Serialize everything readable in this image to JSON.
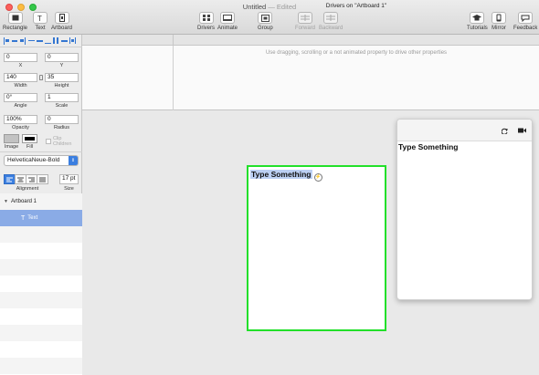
{
  "window": {
    "title": "Untitled",
    "status": "Edited",
    "separator": "—"
  },
  "toolbar": {
    "rectangle": "Rectangle",
    "text": "Text",
    "artboard": "Artboard",
    "drivers": "Drivers",
    "animate": "Animate",
    "group": "Group",
    "forward": "Forward",
    "backward": "Backward",
    "tutorials": "Tutorials",
    "mirror": "Mirror",
    "feedback": "Feedback"
  },
  "inspector": {
    "x": {
      "value": "0",
      "label": "X"
    },
    "y": {
      "value": "0",
      "label": "Y"
    },
    "width": {
      "value": "140",
      "label": "Width"
    },
    "height": {
      "value": "35",
      "label": "Height"
    },
    "angle": {
      "value": "0°",
      "label": "Angle"
    },
    "scale": {
      "value": "1",
      "label": "Scale"
    },
    "opacity": {
      "value": "100%",
      "label": "Opacity"
    },
    "radius": {
      "value": "0",
      "label": "Radius"
    },
    "image_label": "Image",
    "fill_label": "Fill",
    "clip_children": "Clip Children",
    "font": "HelveticaNeue-Bold",
    "size": {
      "value": "17 pt",
      "label": "Size"
    },
    "alignment_label": "Alignment",
    "colors": {
      "image": "#c2c2c2",
      "fill": "#000000"
    }
  },
  "layers": [
    {
      "name": "Artboard 1",
      "icon": "disclosure-triangle-icon",
      "selected": false
    },
    {
      "name": "Text",
      "icon": "text-tool-icon",
      "selected": true
    }
  ],
  "drivers": {
    "title": "Drivers on \"Artboard 1\"",
    "hint": "Use dragging, scrolling or a not animated property to drive other properties"
  },
  "canvas": {
    "artboard_text": "Type Something",
    "preview_text": "Type Something",
    "artboard_border_color": "#22e02a"
  }
}
